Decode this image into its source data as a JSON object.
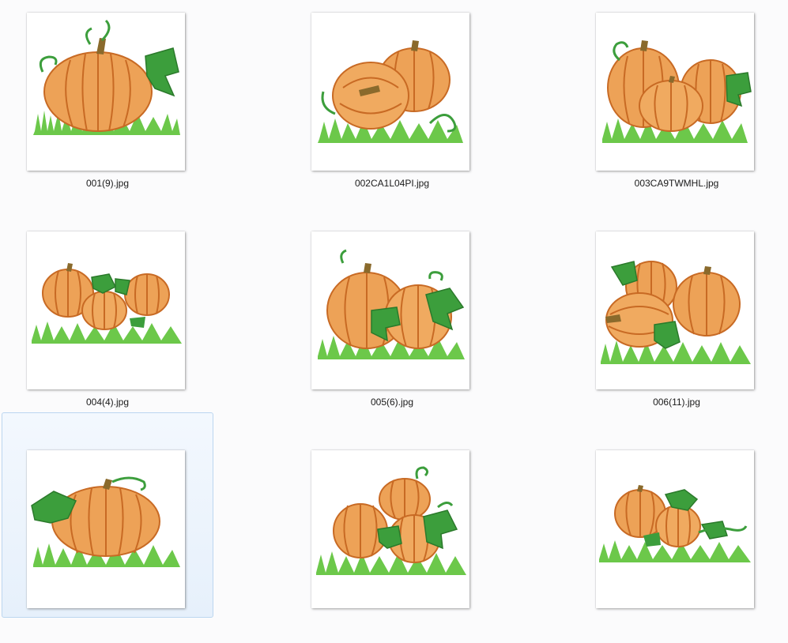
{
  "files": [
    {
      "name": "001(9).jpg",
      "selected": false,
      "thumbnail": "single large pumpkin with vine curls and leaf on grass"
    },
    {
      "name": "002CA1L04PI.jpg",
      "selected": false,
      "thumbnail": "two pumpkins, one tipped over, with vine curls on grass"
    },
    {
      "name": "003CA9TWMHL.jpg",
      "selected": false,
      "thumbnail": "three pumpkins cluster with leaf on grass"
    },
    {
      "name": "004(4).jpg",
      "selected": false,
      "thumbnail": "three small pumpkins with leaves on grass"
    },
    {
      "name": "005(6).jpg",
      "selected": false,
      "thumbnail": "two pumpkins with leaves and curl on grass"
    },
    {
      "name": "006(11).jpg",
      "selected": false,
      "thumbnail": "three pumpkins stacked with leaves on grass"
    },
    {
      "name": "",
      "selected": true,
      "thumbnail": "single wide pumpkin with leaf and curl on grass"
    },
    {
      "name": "",
      "selected": false,
      "thumbnail": "three pumpkins with leaves and curls on grass"
    },
    {
      "name": "",
      "selected": false,
      "thumbnail": "two pumpkins with leaves and vine on grass"
    }
  ],
  "colors": {
    "pumpkin": "#eda257",
    "pumpkin_dark": "#c86a24",
    "stem": "#8a6a2c",
    "leaf": "#3c9e3c",
    "grass": "#6cc84a",
    "grass_red": "#d84a2a",
    "selection_border": "#bcd6f0"
  }
}
